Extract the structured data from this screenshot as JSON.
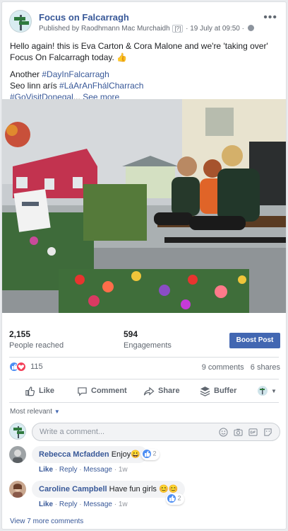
{
  "post": {
    "page_name": "Focus on Falcarragh",
    "meta_prefix": "Published by Raodhmann Mac Murchaidh",
    "meta_q": "[?]",
    "meta_suffix": "· 19 July at 09:50 ·",
    "more": "•••",
    "line1": "Hello again! this is Eva Carton & Cora Malone and we're 'taking over' Focus On Falcarragh today. 👍",
    "line2a": "Another ",
    "tag1": "#DayInFalcarragh",
    "line3a": "Seo linn arís ",
    "tag2": "#LáArAnFhálCharrach",
    "tag3": "#GoVisitDonegal",
    "ellipsis": "... ",
    "see_more": "See more"
  },
  "stats": {
    "reached_num": "2,155",
    "reached_label": "People reached",
    "eng_num": "594",
    "eng_label": "Engagements",
    "boost": "Boost Post"
  },
  "reactions": {
    "count": "115",
    "comments": "9 comments",
    "shares": "6 shares"
  },
  "actions": {
    "like": "Like",
    "comment": "Comment",
    "share": "Share",
    "buffer": "Buffer"
  },
  "comments_section": {
    "sort": "Most relevant",
    "placeholder": "Write a comment...",
    "items": [
      {
        "author": "Rebecca Mcfadden",
        "text": "Enjoy😀",
        "react_count": "2",
        "like": "Like",
        "reply": "Reply",
        "message": "Message",
        "time": "1w"
      },
      {
        "author": "Caroline Campbell",
        "text": "Have fun girls 😊😊",
        "react_count": "2",
        "like": "Like",
        "reply": "Reply",
        "message": "Message",
        "time": "1w"
      }
    ],
    "view_more": "View 7 more comments"
  },
  "colors": {
    "brand": "#4267b2",
    "link": "#385898",
    "like": "#4d8ef3",
    "love": "#f33e58"
  },
  "icons": [
    "page-avatar",
    "globe-icon",
    "more-icon",
    "like-reaction-icon",
    "love-reaction-icon",
    "thumbs-up-icon",
    "comment-icon",
    "share-icon",
    "buffer-icon",
    "emoji-icon",
    "camera-icon",
    "gif-icon",
    "sticker-icon"
  ]
}
